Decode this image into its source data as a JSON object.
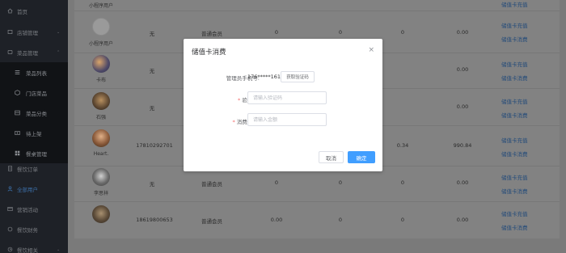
{
  "sidebar": {
    "items": [
      {
        "label": "首页",
        "icon": "home-icon"
      },
      {
        "label": "店铺管理",
        "icon": "store-icon"
      },
      {
        "label": "菜品管理",
        "icon": "dish-icon"
      },
      {
        "label": "菜品列表",
        "icon": "list-icon"
      },
      {
        "label": "门店菜品",
        "icon": "cube-icon"
      },
      {
        "label": "菜品分类",
        "icon": "category-icon"
      },
      {
        "label": "待上架",
        "icon": "shelf-icon"
      },
      {
        "label": "餐桌管理",
        "icon": "table-icon"
      },
      {
        "label": "餐饮订单",
        "icon": "order-icon"
      },
      {
        "label": "全部用户",
        "icon": "user-icon"
      },
      {
        "label": "营销活动",
        "icon": "marketing-icon"
      },
      {
        "label": "餐饮财务",
        "icon": "finance-icon"
      },
      {
        "label": "餐饮相关",
        "icon": "related-icon"
      }
    ]
  },
  "table": {
    "rows": [
      {
        "name": "小程序用户",
        "phone": "",
        "level": "",
        "c1": "",
        "c2": "",
        "c3": "",
        "c4": "",
        "actions": [
          "储值卡充值"
        ]
      },
      {
        "name": "小程序用户",
        "phone": "无",
        "level": "普通会员",
        "c1": "0",
        "c2": "0",
        "c3": "0",
        "c4": "0.00",
        "actions": [
          "储值卡充值",
          "储值卡消费"
        ]
      },
      {
        "name": "卡布",
        "phone": "无",
        "level": "",
        "c1": "",
        "c2": "",
        "c3": "",
        "c4": "0.00",
        "actions": [
          "储值卡充值",
          "储值卡消费"
        ]
      },
      {
        "name": "石强",
        "phone": "无",
        "level": "",
        "c1": "",
        "c2": "",
        "c3": "",
        "c4": "0.00",
        "actions": [
          "储值卡充值",
          "储值卡消费"
        ]
      },
      {
        "name": "Heart.",
        "phone": "17810292701",
        "level": "",
        "c1": "",
        "c2": "",
        "c3": "0.34",
        "c4": "990.84",
        "actions": [
          "储值卡充值",
          "储值卡消费"
        ]
      },
      {
        "name": "李思祥",
        "phone": "无",
        "level": "普通会员",
        "c1": "0",
        "c2": "0",
        "c3": "0",
        "c4": "0.00",
        "actions": [
          "储值卡充值",
          "储值卡消费"
        ]
      },
      {
        "name": "",
        "phone": "18619800653",
        "level": "普通会员",
        "c1": "0.00",
        "c2": "0",
        "c3": "0",
        "c4": "0.00",
        "actions": [
          "储值卡充值",
          "储值卡消费"
        ]
      }
    ]
  },
  "modal": {
    "title": "储值卡消费",
    "close": "×",
    "phone_label": "管理员手机号:",
    "phone_value": "176*****1615",
    "get_code": "获取验证码",
    "code_label": "验证码:",
    "code_placeholder": "请输入验证码",
    "amount_label": "消费金额:",
    "amount_placeholder": "请输入金额",
    "required_mark": "*",
    "cancel": "取消",
    "confirm": "确定"
  }
}
